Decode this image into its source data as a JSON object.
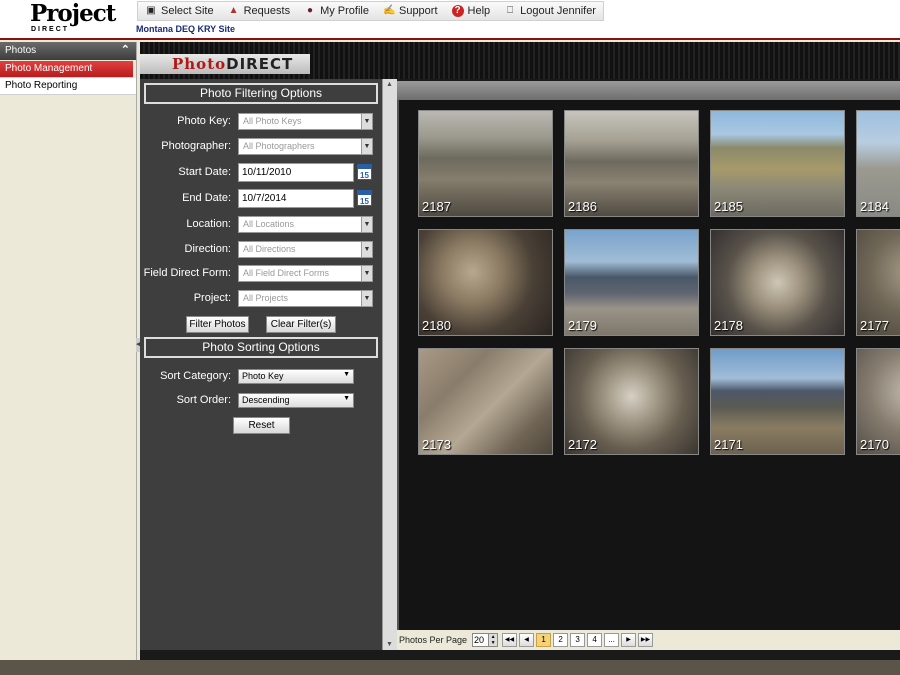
{
  "header": {
    "logo_top": "Project",
    "logo_bottom": "DIRECT",
    "site_name": "Montana DEQ KRY Site",
    "nav": [
      {
        "icon": "sitemap-icon",
        "label": "Select Site"
      },
      {
        "icon": "requests-icon",
        "label": "Requests"
      },
      {
        "icon": "user-icon",
        "label": "My Profile"
      },
      {
        "icon": "support-icon",
        "label": "Support"
      },
      {
        "icon": "help-icon",
        "label": "Help"
      },
      {
        "icon": "lock-icon",
        "label": "Logout Jennifer"
      }
    ]
  },
  "sidebar": {
    "title": "Photos",
    "items": [
      {
        "label": "Photo Management",
        "active": true
      },
      {
        "label": "Photo Reporting",
        "active": false
      }
    ]
  },
  "banner": {
    "photo": "Photo",
    "direct": "DIRECT"
  },
  "filter": {
    "title": "Photo Filtering Options",
    "photo_key_label": "Photo Key:",
    "photo_key_value": "All Photo Keys",
    "photographer_label": "Photographer:",
    "photographer_value": "All Photographers",
    "start_date_label": "Start Date:",
    "start_date_value": "10/11/2010",
    "end_date_label": "End Date:",
    "end_date_value": "10/7/2014",
    "location_label": "Location:",
    "location_value": "All Locations",
    "direction_label": "Direction:",
    "direction_value": "All Directions",
    "form_label": "Field Direct Form:",
    "form_value": "All Field Direct Forms",
    "project_label": "Project:",
    "project_value": "All Projects",
    "calendar_day": "15",
    "filter_button": "Filter Photos",
    "clear_button": "Clear Filter(s)"
  },
  "sorting": {
    "title": "Photo Sorting Options",
    "category_label": "Sort Category:",
    "category_value": "Photo Key",
    "order_label": "Sort Order:",
    "order_value": "Descending",
    "reset_button": "Reset"
  },
  "gallery": {
    "photos": [
      "2187",
      "2186",
      "2185",
      "2184",
      "2180",
      "2179",
      "2178",
      "2177",
      "2173",
      "2172",
      "2171",
      "2170"
    ]
  },
  "pager": {
    "per_page_label": "Photos Per Page",
    "per_page_value": "20",
    "pages": [
      "1",
      "2",
      "3",
      "4",
      "..."
    ],
    "current_page": "1"
  }
}
